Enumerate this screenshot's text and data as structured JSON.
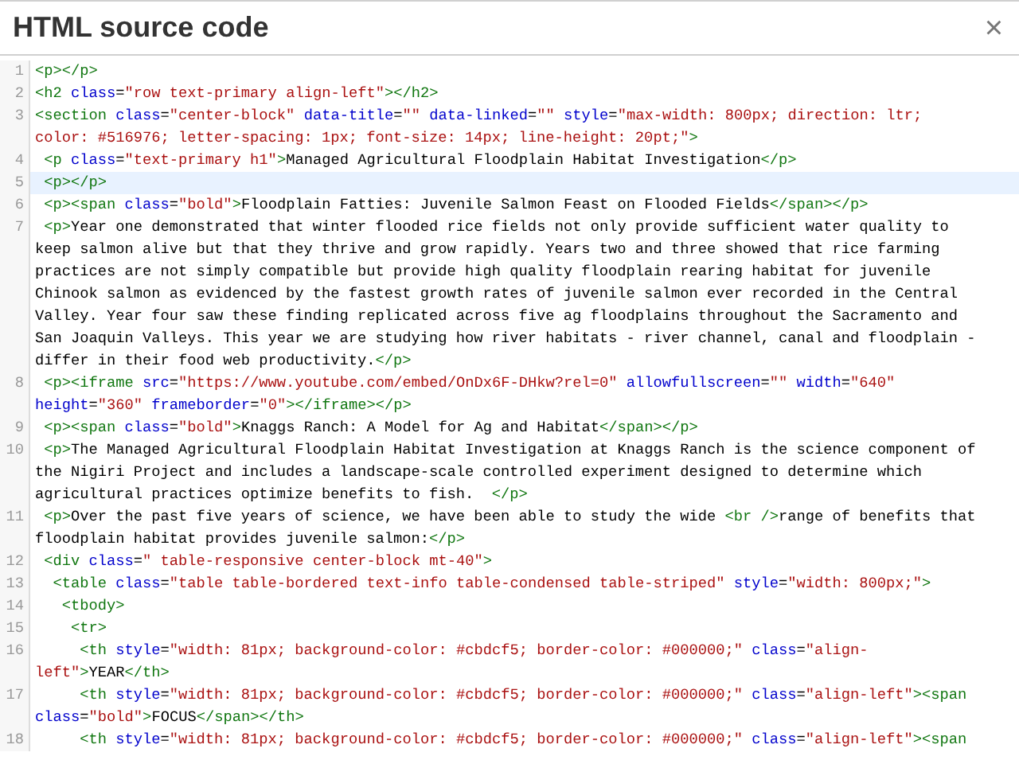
{
  "dialog": {
    "title": "HTML source code",
    "close": "×"
  },
  "lines": [
    {
      "number": "1",
      "active": false,
      "tokens": [
        {
          "kind": "tag",
          "text": "<p></p>"
        }
      ]
    },
    {
      "number": "2",
      "active": false,
      "tokens": [
        {
          "kind": "tag",
          "text": "<h2"
        },
        {
          "kind": "attr",
          "text": " class"
        },
        {
          "kind": "plain",
          "text": "="
        },
        {
          "kind": "string",
          "text": "\"row text-primary align-left\""
        },
        {
          "kind": "tag",
          "text": "></h2>"
        }
      ]
    },
    {
      "number": "3",
      "active": false,
      "tokens": [
        {
          "kind": "tag",
          "text": "<section"
        },
        {
          "kind": "attr",
          "text": " class"
        },
        {
          "kind": "plain",
          "text": "="
        },
        {
          "kind": "string",
          "text": "\"center-block\""
        },
        {
          "kind": "attr",
          "text": " data-title"
        },
        {
          "kind": "plain",
          "text": "="
        },
        {
          "kind": "string",
          "text": "\"\""
        },
        {
          "kind": "attr",
          "text": " data-linked"
        },
        {
          "kind": "plain",
          "text": "="
        },
        {
          "kind": "string",
          "text": "\"\""
        },
        {
          "kind": "attr",
          "text": " style"
        },
        {
          "kind": "plain",
          "text": "="
        },
        {
          "kind": "string",
          "text": "\"max-width: 800px; direction: ltr;"
        },
        {
          "kind": "wrap"
        },
        {
          "kind": "string",
          "text": "color: #516976; letter-spacing: 1px; font-size: 14px; line-height: 20pt;\""
        },
        {
          "kind": "tag",
          "text": ">"
        }
      ]
    },
    {
      "number": "4",
      "active": false,
      "tokens": [
        {
          "kind": "tag",
          "text": " <p"
        },
        {
          "kind": "attr",
          "text": " class"
        },
        {
          "kind": "plain",
          "text": "="
        },
        {
          "kind": "string",
          "text": "\"text-primary h1\""
        },
        {
          "kind": "tag",
          "text": ">"
        },
        {
          "kind": "plain",
          "text": "Managed Agricultural Floodplain Habitat Investigation"
        },
        {
          "kind": "tag",
          "text": "</p>"
        }
      ]
    },
    {
      "number": "5",
      "active": true,
      "tokens": [
        {
          "kind": "tag",
          "text": " <p></p>"
        }
      ]
    },
    {
      "number": "6",
      "active": false,
      "tokens": [
        {
          "kind": "tag",
          "text": " <p><span"
        },
        {
          "kind": "attr",
          "text": " class"
        },
        {
          "kind": "plain",
          "text": "="
        },
        {
          "kind": "string",
          "text": "\"bold\""
        },
        {
          "kind": "tag",
          "text": ">"
        },
        {
          "kind": "plain",
          "text": "Floodplain Fatties: Juvenile Salmon Feast on Flooded Fields"
        },
        {
          "kind": "tag",
          "text": "</span></p>"
        }
      ]
    },
    {
      "number": "7",
      "active": false,
      "tokens": [
        {
          "kind": "tag",
          "text": " <p>"
        },
        {
          "kind": "plain",
          "text": "Year one demonstrated that winter flooded rice fields not only provide sufficient water quality to"
        },
        {
          "kind": "wrap"
        },
        {
          "kind": "plain",
          "text": "keep salmon alive but that they thrive and grow rapidly. Years two and three showed that rice farming"
        },
        {
          "kind": "wrap"
        },
        {
          "kind": "plain",
          "text": "practices are not simply compatible but provide high quality floodplain rearing habitat for juvenile"
        },
        {
          "kind": "wrap"
        },
        {
          "kind": "plain",
          "text": "Chinook salmon as evidenced by the fastest growth rates of juvenile salmon ever recorded in the Central"
        },
        {
          "kind": "wrap"
        },
        {
          "kind": "plain",
          "text": "Valley. Year four saw these finding replicated across five ag floodplains throughout the Sacramento and"
        },
        {
          "kind": "wrap"
        },
        {
          "kind": "plain",
          "text": "San Joaquin Valleys. This year we are studying how river habitats - river channel, canal and floodplain -"
        },
        {
          "kind": "wrap"
        },
        {
          "kind": "plain",
          "text": "differ in their food web productivity."
        },
        {
          "kind": "tag",
          "text": "</p>"
        }
      ]
    },
    {
      "number": "8",
      "active": false,
      "tokens": [
        {
          "kind": "tag",
          "text": " <p><iframe"
        },
        {
          "kind": "attr",
          "text": " src"
        },
        {
          "kind": "plain",
          "text": "="
        },
        {
          "kind": "string",
          "text": "\"https://www.youtube.com/embed/OnDx6F-DHkw?rel=0\""
        },
        {
          "kind": "attr",
          "text": " allowfullscreen"
        },
        {
          "kind": "plain",
          "text": "="
        },
        {
          "kind": "string",
          "text": "\"\""
        },
        {
          "kind": "attr",
          "text": " width"
        },
        {
          "kind": "plain",
          "text": "="
        },
        {
          "kind": "string",
          "text": "\"640\""
        },
        {
          "kind": "wrap"
        },
        {
          "kind": "attr",
          "text": "height"
        },
        {
          "kind": "plain",
          "text": "="
        },
        {
          "kind": "string",
          "text": "\"360\""
        },
        {
          "kind": "attr",
          "text": " frameborder"
        },
        {
          "kind": "plain",
          "text": "="
        },
        {
          "kind": "string",
          "text": "\"0\""
        },
        {
          "kind": "tag",
          "text": "></iframe></p>"
        }
      ]
    },
    {
      "number": "9",
      "active": false,
      "tokens": [
        {
          "kind": "tag",
          "text": " <p><span"
        },
        {
          "kind": "attr",
          "text": " class"
        },
        {
          "kind": "plain",
          "text": "="
        },
        {
          "kind": "string",
          "text": "\"bold\""
        },
        {
          "kind": "tag",
          "text": ">"
        },
        {
          "kind": "plain",
          "text": "Knaggs Ranch: A Model for Ag and Habitat"
        },
        {
          "kind": "tag",
          "text": "</span></p>"
        }
      ]
    },
    {
      "number": "10",
      "active": false,
      "tokens": [
        {
          "kind": "tag",
          "text": " <p>"
        },
        {
          "kind": "plain",
          "text": "The Managed Agricultural Floodplain Habitat Investigation at Knaggs Ranch is the science component of"
        },
        {
          "kind": "wrap"
        },
        {
          "kind": "plain",
          "text": "the Nigiri Project and includes a landscape-scale controlled experiment designed to determine which"
        },
        {
          "kind": "wrap"
        },
        {
          "kind": "plain",
          "text": "agricultural practices optimize benefits to fish."
        },
        {
          "kind": "tag",
          "text": "  </p>"
        }
      ]
    },
    {
      "number": "11",
      "active": false,
      "tokens": [
        {
          "kind": "tag",
          "text": " <p>"
        },
        {
          "kind": "plain",
          "text": "Over the past five years of science, we have been able to study the wide"
        },
        {
          "kind": "tag",
          "text": " <br />"
        },
        {
          "kind": "plain",
          "text": "range of benefits that"
        },
        {
          "kind": "wrap"
        },
        {
          "kind": "plain",
          "text": "floodplain habitat provides juvenile salmon:"
        },
        {
          "kind": "tag",
          "text": "</p>"
        }
      ]
    },
    {
      "number": "12",
      "active": false,
      "tokens": [
        {
          "kind": "tag",
          "text": " <div"
        },
        {
          "kind": "attr",
          "text": " class"
        },
        {
          "kind": "plain",
          "text": "="
        },
        {
          "kind": "string",
          "text": "\" table-responsive center-block mt-40\""
        },
        {
          "kind": "tag",
          "text": ">"
        }
      ]
    },
    {
      "number": "13",
      "active": false,
      "tokens": [
        {
          "kind": "tag",
          "text": "  <table"
        },
        {
          "kind": "attr",
          "text": " class"
        },
        {
          "kind": "plain",
          "text": "="
        },
        {
          "kind": "string",
          "text": "\"table table-bordered text-info table-condensed table-striped\""
        },
        {
          "kind": "attr",
          "text": " style"
        },
        {
          "kind": "plain",
          "text": "="
        },
        {
          "kind": "string",
          "text": "\"width: 800px;\""
        },
        {
          "kind": "tag",
          "text": ">"
        }
      ]
    },
    {
      "number": "14",
      "active": false,
      "tokens": [
        {
          "kind": "tag",
          "text": "   <tbody>"
        }
      ]
    },
    {
      "number": "15",
      "active": false,
      "tokens": [
        {
          "kind": "tag",
          "text": "    <tr>"
        }
      ]
    },
    {
      "number": "16",
      "active": false,
      "tokens": [
        {
          "kind": "tag",
          "text": "     <th"
        },
        {
          "kind": "attr",
          "text": " style"
        },
        {
          "kind": "plain",
          "text": "="
        },
        {
          "kind": "string",
          "text": "\"width: 81px; background-color: #cbdcf5; border-color: #000000;\""
        },
        {
          "kind": "attr",
          "text": " class"
        },
        {
          "kind": "plain",
          "text": "="
        },
        {
          "kind": "string",
          "text": "\"align-"
        },
        {
          "kind": "wrap"
        },
        {
          "kind": "string",
          "text": "left\""
        },
        {
          "kind": "tag",
          "text": ">"
        },
        {
          "kind": "plain",
          "text": "YEAR"
        },
        {
          "kind": "tag",
          "text": "</th>"
        }
      ]
    },
    {
      "number": "17",
      "active": false,
      "tokens": [
        {
          "kind": "tag",
          "text": "     <th"
        },
        {
          "kind": "attr",
          "text": " style"
        },
        {
          "kind": "plain",
          "text": "="
        },
        {
          "kind": "string",
          "text": "\"width: 81px; background-color: #cbdcf5; border-color: #000000;\""
        },
        {
          "kind": "attr",
          "text": " class"
        },
        {
          "kind": "plain",
          "text": "="
        },
        {
          "kind": "string",
          "text": "\"align-left\""
        },
        {
          "kind": "tag",
          "text": "><span"
        },
        {
          "kind": "wrap"
        },
        {
          "kind": "attr",
          "text": "class"
        },
        {
          "kind": "plain",
          "text": "="
        },
        {
          "kind": "string",
          "text": "\"bold\""
        },
        {
          "kind": "tag",
          "text": ">"
        },
        {
          "kind": "plain",
          "text": "FOCUS"
        },
        {
          "kind": "tag",
          "text": "</span></th>"
        }
      ]
    },
    {
      "number": "18",
      "active": false,
      "tokens": [
        {
          "kind": "tag",
          "text": "     <th"
        },
        {
          "kind": "attr",
          "text": " style"
        },
        {
          "kind": "plain",
          "text": "="
        },
        {
          "kind": "string",
          "text": "\"width: 81px; background-color: #cbdcf5; border-color: #000000;\""
        },
        {
          "kind": "attr",
          "text": " class"
        },
        {
          "kind": "plain",
          "text": "="
        },
        {
          "kind": "string",
          "text": "\"align-left\""
        },
        {
          "kind": "tag",
          "text": "><span"
        }
      ]
    }
  ]
}
